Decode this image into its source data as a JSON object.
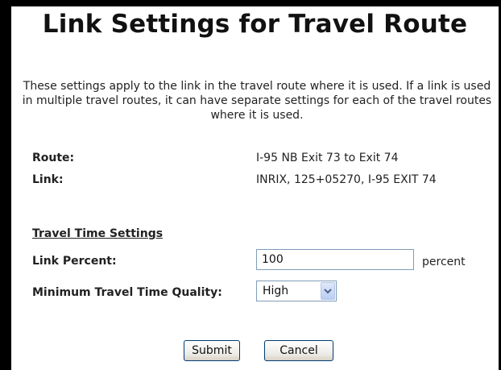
{
  "page": {
    "title": "Link Settings for Travel Route",
    "intro": "These settings apply to the link in the travel route where it is used. If a link is used in multiple travel routes, it can have separate settings for each of the travel routes where it is used."
  },
  "info": {
    "route_label": "Route:",
    "route_value": "I-95 NB Exit 73 to Exit 74",
    "link_label": "Link:",
    "link_value": "INRIX, 125+05270, I-95 EXIT 74"
  },
  "travel_time": {
    "heading": "Travel Time Settings",
    "link_percent_label": "Link Percent:",
    "link_percent_value": "100",
    "link_percent_unit": "percent",
    "quality_label": "Minimum Travel Time Quality:",
    "quality_value": "High"
  },
  "buttons": {
    "submit": "Submit",
    "cancel": "Cancel"
  },
  "icons": {
    "select_arrow": "chevron-down-icon"
  }
}
